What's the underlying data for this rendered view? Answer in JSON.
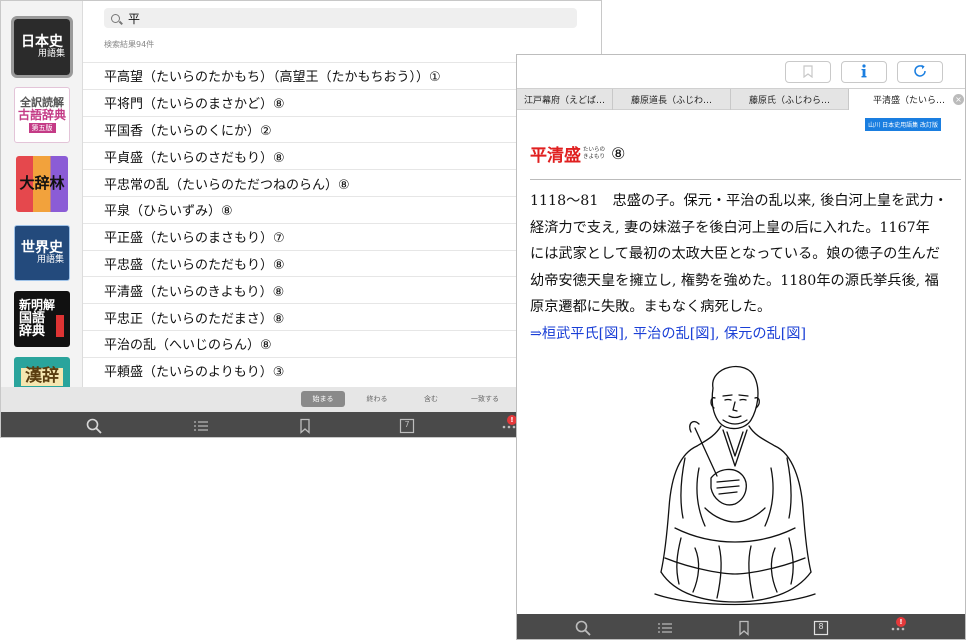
{
  "search": {
    "query": "平",
    "result_count": "検索結果94件"
  },
  "sidebar": {
    "dicts": [
      {
        "line1": "日本史",
        "line2": "用語集"
      },
      {
        "line1": "全訳読解",
        "line2": "古語辞典",
        "line3": "第五版"
      },
      {
        "line1": "大辞林"
      },
      {
        "line1": "世界史",
        "line2": "用語集"
      },
      {
        "line1": "新明解",
        "line2": "国語",
        "line3": "辞典"
      },
      {
        "line1": "漢辞"
      }
    ]
  },
  "results": [
    "平高望（たいらのたかもち）（高望王（たかもちおう））①",
    "平将門（たいらのまさかど）⑧",
    "平国香（たいらのくにか）②",
    "平貞盛（たいらのさだもり）⑧",
    "平忠常の乱（たいらのただつねのらん）⑧",
    "平泉（ひらいずみ）⑧",
    "平正盛（たいらのまさもり）⑦",
    "平忠盛（たいらのただもり）⑧",
    "平清盛（たいらのきよもり）⑧",
    "平忠正（たいらのただまさ）⑧",
    "平治の乱（へいじのらん）⑧",
    "平頼盛（たいらのよりもり）③"
  ],
  "search_modes": [
    {
      "label": "始まる",
      "active": true
    },
    {
      "label": "終わる",
      "active": false
    },
    {
      "label": "含む",
      "active": false
    },
    {
      "label": "一致する",
      "active": false
    }
  ],
  "tabbar_back": {
    "history_count": "7",
    "badge": "!"
  },
  "tabbar_front": {
    "history_count": "8",
    "badge": "!"
  },
  "history_tabs": [
    {
      "label": "江戸幕府（えどば…",
      "active": false
    },
    {
      "label": "藤原道長（ふじわ…",
      "active": false
    },
    {
      "label": "藤原氏（ふじわら…",
      "active": false
    },
    {
      "label": "平清盛（たいら…",
      "active": true
    }
  ],
  "entry": {
    "source": "山川 日本史用語集 改訂版",
    "headword": "平清盛",
    "reading_top": "たいらの",
    "reading_bottom": "きよもり",
    "frequency": "⑧",
    "body": [
      "1118～81　忠盛の子。保元・平治の乱以来, 後白河上皇を武力・",
      "経済力で支え, 妻の妹滋子を後白河上皇の后に入れた。1167年",
      "には武家として最初の太政大臣となっている。娘の徳子の生んだ",
      "幼帝安徳天皇を擁立し, 権勢を強めた。1180年の源氏挙兵後, 福",
      "原京遷都に失敗。まもなく病死した。"
    ],
    "xref_arrow": "⇒",
    "xrefs": [
      "桓武平氏[図]",
      "平治の乱[図]",
      "保元の乱[図]"
    ],
    "xref_sep": ", "
  },
  "colors": {
    "headword": "#e02020",
    "link": "#1a3fd6",
    "source_label": "#1a7ee0",
    "tabbar": "#4a4a4a",
    "badge": "#e5393b"
  },
  "icons": {
    "toolbar": [
      "bookmark-icon",
      "info-icon",
      "refresh-icon"
    ],
    "tabbar": [
      "search-icon",
      "list-icon",
      "bookmark-icon",
      "history-icon",
      "more-icon"
    ]
  }
}
